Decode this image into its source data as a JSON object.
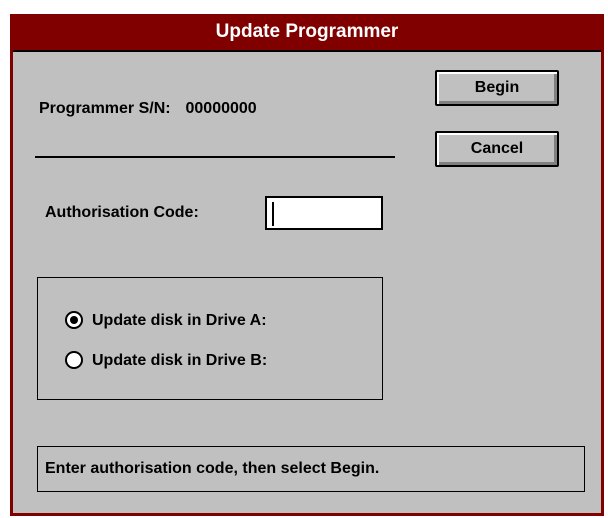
{
  "window": {
    "title": "Update Programmer"
  },
  "buttons": {
    "begin": "Begin",
    "cancel": "Cancel"
  },
  "serial": {
    "label": "Programmer S/N:",
    "value": "00000000"
  },
  "authorisation": {
    "label": "Authorisation Code:",
    "value": ""
  },
  "drive_options": [
    {
      "label": "Update disk in Drive A:",
      "selected": true
    },
    {
      "label": "Update disk in Drive B:",
      "selected": false
    }
  ],
  "status_text": "Enter authorisation code,  then select Begin."
}
